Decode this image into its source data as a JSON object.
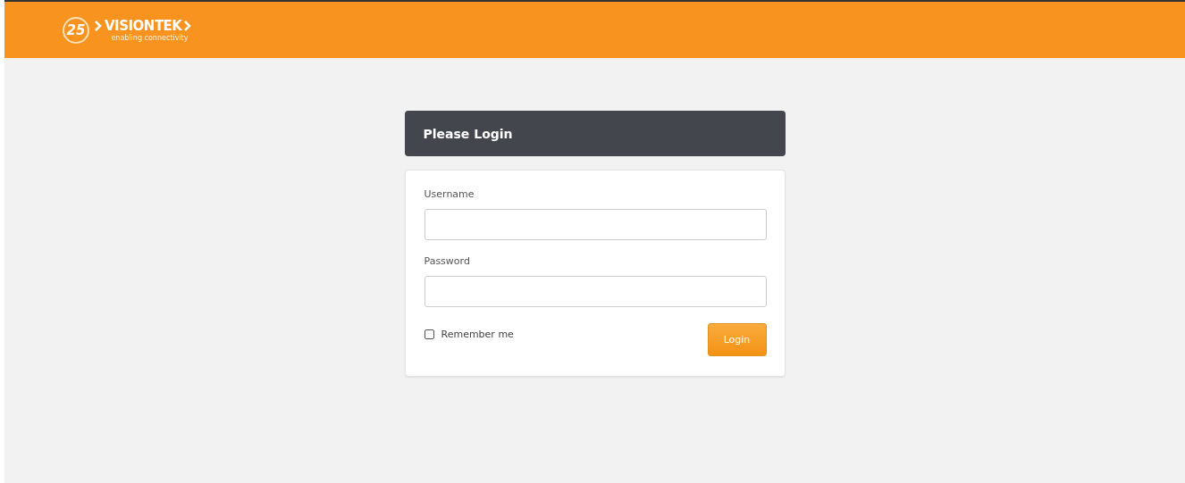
{
  "header": {
    "logo": {
      "badge": "25",
      "name": "VISIONTEK",
      "tagline": "enabling connectivity"
    }
  },
  "login": {
    "title": "Please Login",
    "fields": [
      {
        "label": "Username"
      },
      {
        "label": "Password"
      }
    ],
    "remember": {
      "label": "Remember me",
      "checked": false
    },
    "button": "Login"
  }
}
